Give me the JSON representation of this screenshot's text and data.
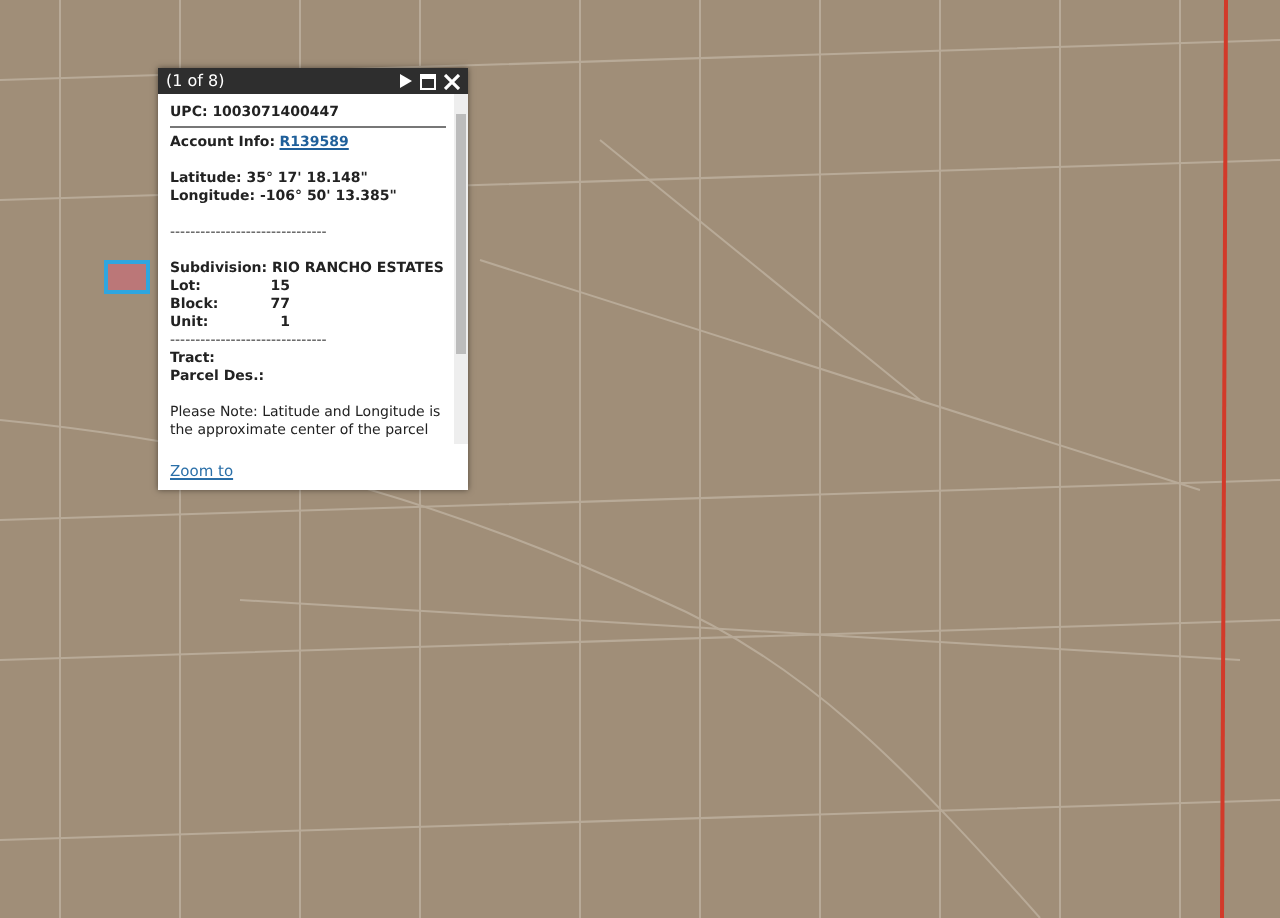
{
  "popup": {
    "title": "(1 of 8)",
    "upc": "UPC: 1003071400447",
    "account_label": "Account Info:",
    "account_link": "R139589",
    "latitude": "Latitude: 35° 17' 18.148\"",
    "longitude": "Longitude: -106° 50' 13.385\"",
    "separator": "-------------------------------",
    "subdivision": "Subdivision: RIO RANCHO ESTATES",
    "fields": [
      {
        "label": "Lot:",
        "value": "15"
      },
      {
        "label": "Block:",
        "value": "77"
      },
      {
        "label": "Unit:",
        "value": "1"
      }
    ],
    "separator_2": "-------------------------------",
    "tract": "Tract:",
    "parcel_des": "Parcel Des.:",
    "note": "Please Note: Latitude and Longitude is the approximate center of the parcel",
    "zoom_link": "Zoom to"
  }
}
